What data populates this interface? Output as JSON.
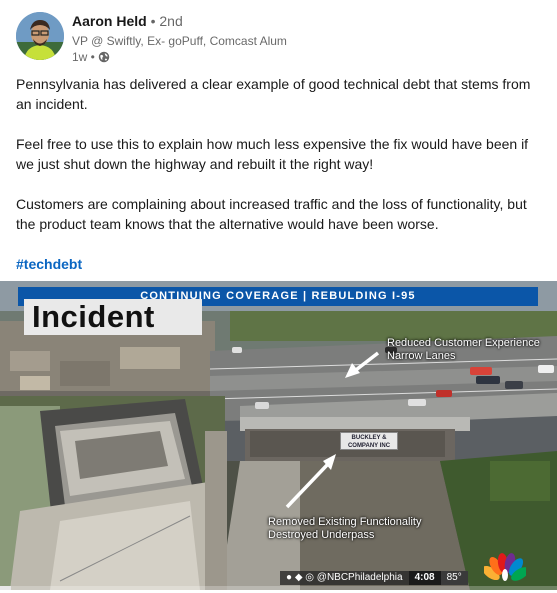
{
  "post": {
    "author": {
      "name": "Aaron Held",
      "degree": "• 2nd",
      "headline": "VP @ Swiftly, Ex- goPuff, Comcast Alum",
      "time": "1w •",
      "visibility_icon": "globe-icon"
    },
    "paragraphs": [
      "Pennsylvania has delivered a clear example of good technical debt that stems from an incident.",
      "Feel free to use this to explain how much less expensive the fix would have been if we just shut down the highway and rebuilt it the right way!",
      "Customers are complaining about increased traffic and the loss of functionality, but the product team knows that the alternative would have been worse."
    ],
    "hashtag": "#techdebt"
  },
  "video": {
    "banner": "CONTINUING COVERAGE  |  REBULDING I-95",
    "incident_label": "Incident",
    "annotation_top": [
      "Reduced Customer Experience",
      "Narrow Lanes"
    ],
    "annotation_bottom": [
      "Removed Existing Functionality",
      "Destroyed Underpass"
    ],
    "signboard": [
      "BUCKLEY &",
      "COMPANY INC"
    ],
    "social_handle": "@NBCPhiladelphia",
    "clock": "4:08",
    "temperature": "85°",
    "progress": 0.02,
    "colors": {
      "banner": "#0b56a8",
      "link": "#0a66c2"
    }
  }
}
